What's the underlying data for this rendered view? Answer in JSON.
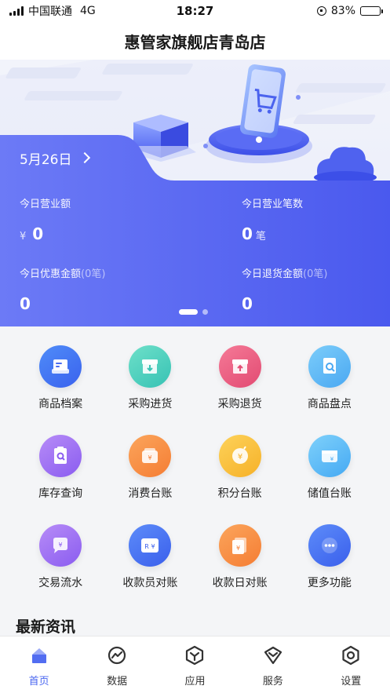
{
  "status_bar": {
    "carrier": "中国联通",
    "network": "4G",
    "time": "18:27",
    "battery": "83%",
    "battery_level": 0.83
  },
  "header": {
    "title": "惠管家旗舰店青岛店"
  },
  "banner": {
    "date": "5月26日",
    "stats": {
      "revenue": {
        "label": "今日营业额",
        "currency": "¥",
        "value": "0"
      },
      "count": {
        "label": "今日营业笔数",
        "value": "0",
        "unit": "笔"
      },
      "discount": {
        "label": "今日优惠金额",
        "sub": "(0笔)",
        "value": "0"
      },
      "refund": {
        "label": "今日退货金额",
        "sub": "(0笔)",
        "value": "0"
      }
    },
    "page_index": 1,
    "page_count": 2
  },
  "features": [
    {
      "label": "商品档案",
      "icon": "product-file-icon",
      "color_from": "#4f8cf8",
      "color_to": "#3a62ee"
    },
    {
      "label": "采购进货",
      "icon": "purchase-in-icon",
      "color_from": "#6ee0c9",
      "color_to": "#36c2b4"
    },
    {
      "label": "采购退货",
      "icon": "purchase-return-icon",
      "color_from": "#f57a97",
      "color_to": "#e24a72"
    },
    {
      "label": "商品盘点",
      "icon": "inventory-check-icon",
      "color_from": "#7ccdfa",
      "color_to": "#4aa8f2"
    },
    {
      "label": "库存查询",
      "icon": "stock-query-icon",
      "color_from": "#b78cf7",
      "color_to": "#8a5cf0"
    },
    {
      "label": "消费台账",
      "icon": "consumption-ledger-icon",
      "color_from": "#fba55c",
      "color_to": "#f57d33"
    },
    {
      "label": "积分台账",
      "icon": "points-ledger-icon",
      "color_from": "#fdd25a",
      "color_to": "#f6b128"
    },
    {
      "label": "储值台账",
      "icon": "stored-value-icon",
      "color_from": "#7fd1fb",
      "color_to": "#45a9f3"
    },
    {
      "label": "交易流水",
      "icon": "transaction-flow-icon",
      "color_from": "#b78cf7",
      "color_to": "#8a5cf0"
    },
    {
      "label": "收款员对账",
      "icon": "cashier-reconcile-icon",
      "color_from": "#5d8cf9",
      "color_to": "#3a5fec"
    },
    {
      "label": "收款日对账",
      "icon": "daily-reconcile-icon",
      "color_from": "#fba55c",
      "color_to": "#f57d33"
    },
    {
      "label": "更多功能",
      "icon": "more-icon",
      "color_from": "#5d8cf9",
      "color_to": "#3a5fec"
    }
  ],
  "news": {
    "title": "最新资讯"
  },
  "tabbar": {
    "active_color": "#4a66f0",
    "items": [
      {
        "label": "首页",
        "icon": "home-icon",
        "active": true
      },
      {
        "label": "数据",
        "icon": "data-icon",
        "active": false
      },
      {
        "label": "应用",
        "icon": "apps-icon",
        "active": false
      },
      {
        "label": "服务",
        "icon": "service-icon",
        "active": false
      },
      {
        "label": "设置",
        "icon": "settings-icon",
        "active": false
      }
    ]
  }
}
